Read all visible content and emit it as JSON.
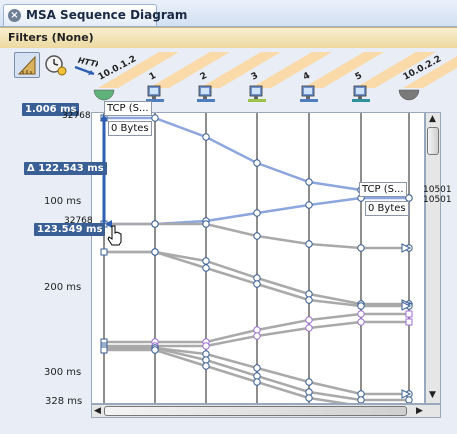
{
  "window": {
    "title": "MSA Sequence Diagram"
  },
  "filterbar": {
    "text": "Filters (None)"
  },
  "toolbar": {
    "tools": [
      "ruler-icon",
      "clock-icon",
      "http-icon"
    ]
  },
  "nodes": [
    {
      "label": "10.0.1.2",
      "kind": "half-circle",
      "color": "#5fb37a"
    },
    {
      "label": "1",
      "kind": "monitor",
      "color": "#4f7fbf"
    },
    {
      "label": "2",
      "kind": "monitor",
      "color": "#4f7fbf"
    },
    {
      "label": "3",
      "kind": "monitor",
      "color": "#9cc24a"
    },
    {
      "label": "4",
      "kind": "monitor",
      "color": "#4f7fbf"
    },
    {
      "label": "5",
      "kind": "monitor",
      "color": "#2f8f9a"
    },
    {
      "label": "10.0.2.2",
      "kind": "half-circle",
      "color": "#7a7a7a"
    }
  ],
  "yaxis": {
    "ticks": [
      "100 ms",
      "200 ms",
      "300 ms",
      "328 ms"
    ]
  },
  "markers": {
    "start": "1.006 ms",
    "delta": "Δ 122.543 ms",
    "end": "123.549 ms"
  },
  "cutoff": [
    "32768",
    "32768"
  ],
  "right_values": [
    "10501",
    "10501"
  ],
  "annotations": [
    {
      "title": "TCP (S...",
      "detail": "0 Bytes"
    },
    {
      "title": "TCP (S...",
      "detail": "0 Bytes"
    }
  ],
  "colors": {
    "blue_line": "#8ea6de",
    "gray_line": "#a9a9a9",
    "purple_dot": "#a070d0"
  }
}
